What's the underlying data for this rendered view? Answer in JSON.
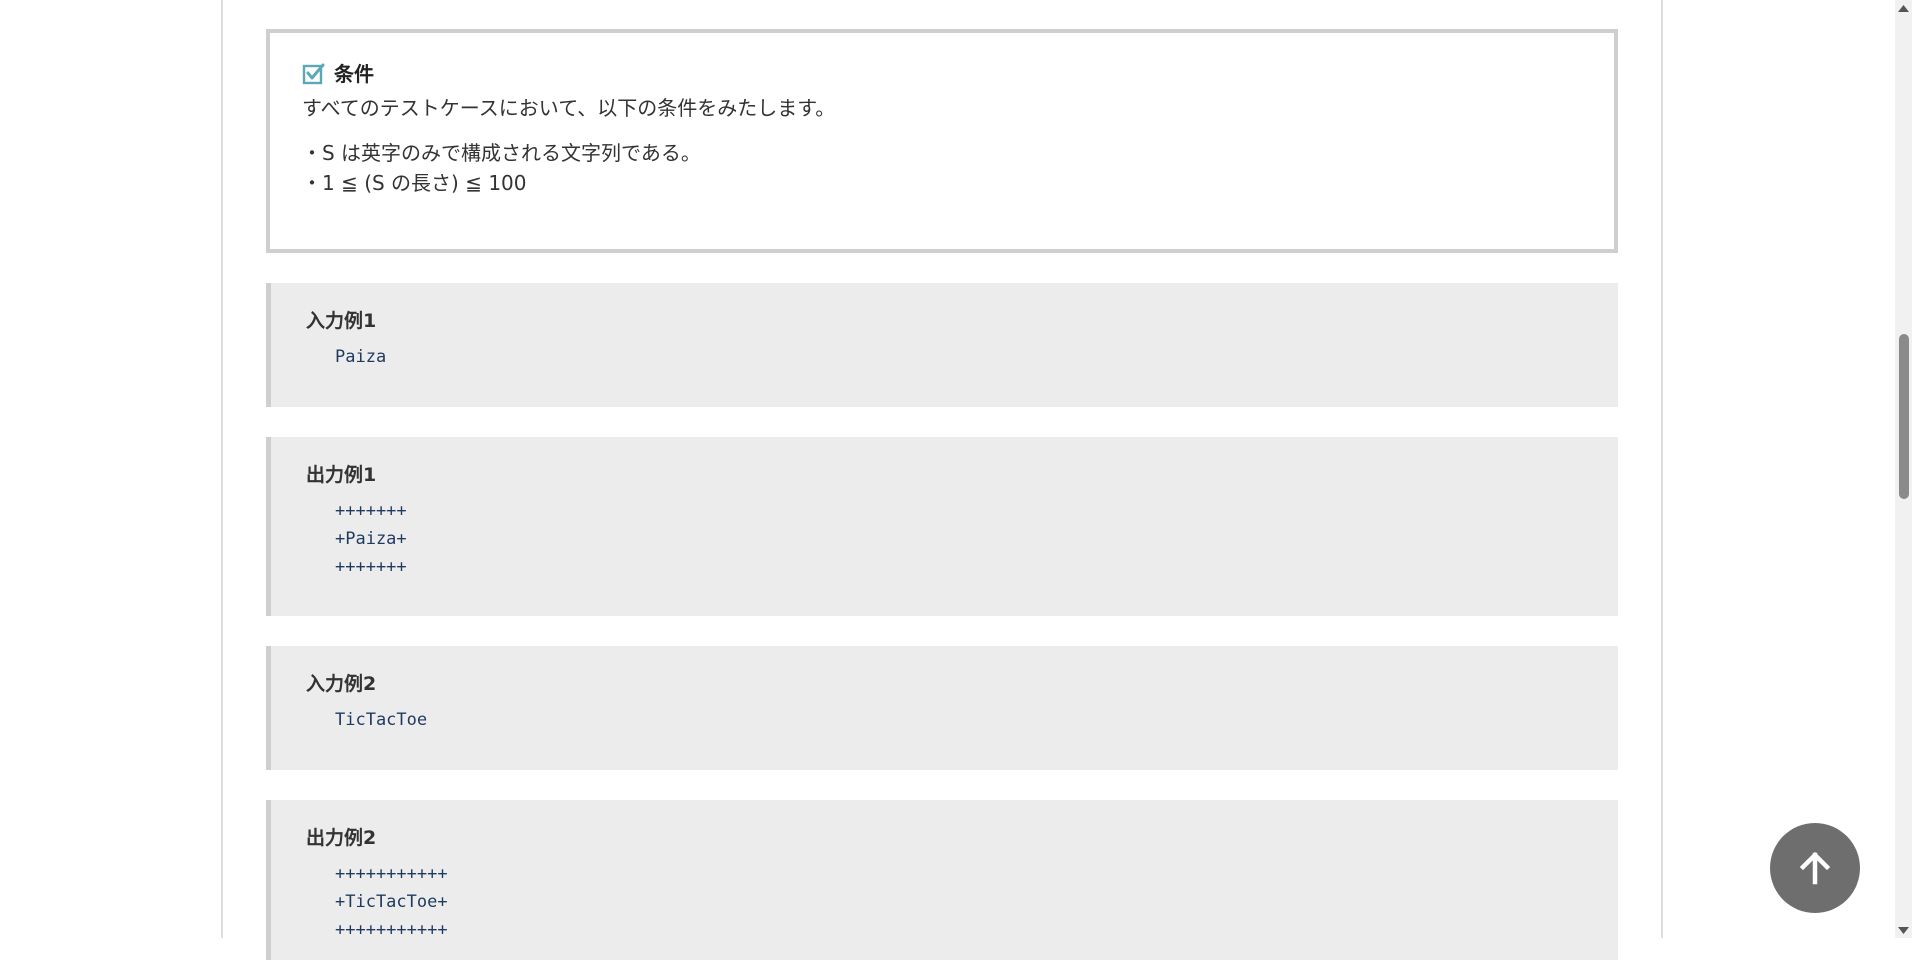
{
  "conditions": {
    "title": "条件",
    "description": "すべてのテストケースにおいて、以下の条件をみたします。",
    "items": [
      "・S は英字のみで構成される文字列である。",
      "・1 ≦ (S の長さ) ≦ 100"
    ],
    "icon": "checkbox-icon",
    "icon_color": "#5aa9b5"
  },
  "examples": [
    {
      "title": "入力例1",
      "code": "Paiza"
    },
    {
      "title": "出力例1",
      "code": "+++++++\n+Paiza+\n+++++++"
    },
    {
      "title": "入力例2",
      "code": "TicTacToe"
    },
    {
      "title": "出力例2",
      "code": "+++++++++++\n+TicTacToe+\n+++++++++++"
    }
  ],
  "scroll_to_top": {
    "icon": "arrow-up-icon",
    "color": "#6e6e6e"
  },
  "colors": {
    "code_text": "#1f3a5f",
    "example_bg": "#ececec",
    "border": "#cfcfcf"
  }
}
